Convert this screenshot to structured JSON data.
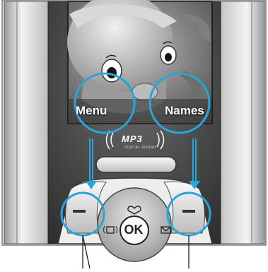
{
  "softkeys": {
    "left_label": "Menu",
    "right_label": "Names"
  },
  "keypad": {
    "ok_label": "OK"
  },
  "logo": {
    "text": "MP3",
    "subtext": "DIGITAL SOUND"
  },
  "colors": {
    "callout": "#29a6d9",
    "body": "#4a4a4a"
  }
}
